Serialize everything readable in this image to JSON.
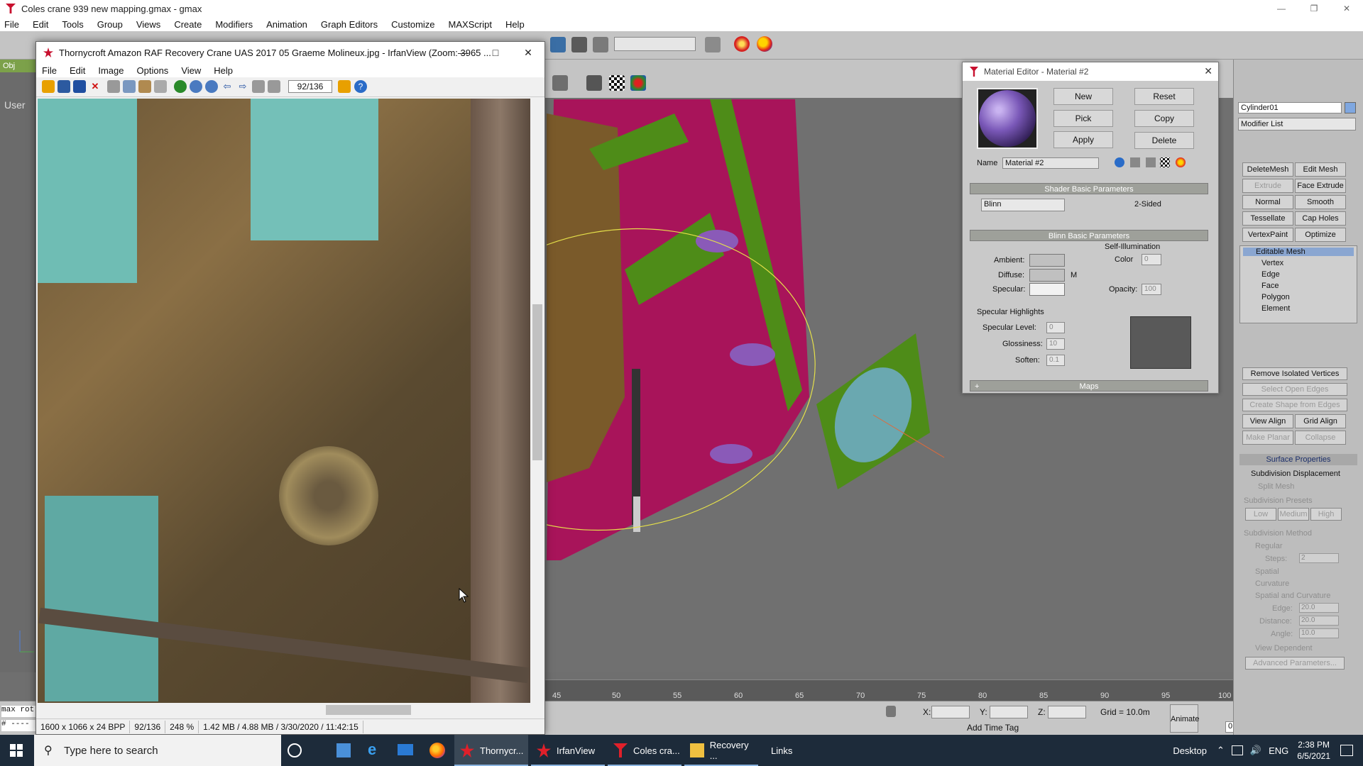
{
  "gmax": {
    "title": "Coles crane 939 new mapping.gmax - gmax",
    "menu": [
      "File",
      "Edit",
      "Tools",
      "Group",
      "Views",
      "Create",
      "Modifiers",
      "Animation",
      "Graph Editors",
      "Customize",
      "MAXScript",
      "Help"
    ],
    "viewport_label": "User",
    "sidebar_tab": "Obj",
    "timeline_ticks": [
      "45",
      "50",
      "55",
      "60",
      "65",
      "70",
      "75",
      "80",
      "85",
      "90",
      "95",
      "100"
    ],
    "status": {
      "y_label": "Y:",
      "z_label": "Z:",
      "grid": "Grid = 10.0m",
      "add_time_tag": "Add Time Tag",
      "animate": "Animate",
      "frame": "0",
      "x_label": "X:",
      "script_label": "max rot",
      "script_line": "# ----"
    }
  },
  "cmd_panel": {
    "object_name": "Cylinder01",
    "modifier_list": "Modifier List",
    "buttons": [
      [
        "DeleteMesh",
        "Edit Mesh"
      ],
      [
        "Extrude",
        "Face Extrude"
      ],
      [
        "Normal",
        "Smooth"
      ],
      [
        "Tessellate",
        "Cap Holes"
      ],
      [
        "VertexPaint",
        "Optimize"
      ]
    ],
    "stack": [
      "Editable Mesh",
      "Vertex",
      "Edge",
      "Face",
      "Polygon",
      "Element"
    ],
    "remove_isolated": "Remove Isolated Vertices",
    "select_open_edges": "Select Open Edges",
    "create_shape": "Create Shape from Edges",
    "view_align": "View Align",
    "grid_align": "Grid Align",
    "make_planar": "Make Planar",
    "collapse": "Collapse",
    "surface_props": "Surface Properties",
    "subdiv_displacement": "Subdivision Displacement",
    "split_mesh": "Split Mesh",
    "subdiv_presets": "Subdivision Presets",
    "presets": [
      "Low",
      "Medium",
      "High"
    ],
    "subdiv_method": "Subdivision Method",
    "regular": "Regular",
    "steps_label": "Steps:",
    "steps_val": "2",
    "spatial": "Spatial",
    "curvature": "Curvature",
    "spatial_curv": "Spatial and Curvature",
    "edge_label": "Edge:",
    "edge_val": "20.0",
    "distance_label": "Distance:",
    "distance_val": "20.0",
    "angle_label": "Angle:",
    "angle_val": "10.0",
    "view_dependent": "View Dependent",
    "advanced_params": "Advanced Parameters..."
  },
  "material_editor": {
    "title": "Material Editor - Material #2",
    "buttons": [
      "New",
      "Reset",
      "Pick",
      "Copy",
      "Apply",
      "Delete"
    ],
    "name_label": "Name",
    "name_value": "Material #2",
    "shader_header": "Shader Basic Parameters",
    "shader": "Blinn",
    "two_sided": "2-Sided",
    "blinn_header": "Blinn Basic Parameters",
    "self_illum": "Self-Illumination",
    "ambient": "Ambient:",
    "diffuse": "Diffuse:",
    "specular": "Specular:",
    "m_label": "M",
    "color_label": "Color",
    "color_val": "0",
    "opacity_label": "Opacity:",
    "opacity_val": "100",
    "spec_highlights": "Specular Highlights",
    "spec_level_label": "Specular Level:",
    "spec_level_val": "0",
    "glossiness_label": "Glossiness:",
    "glossiness_val": "10",
    "soften_label": "Soften:",
    "soften_val": "0.1",
    "maps": "Maps",
    "maps_plus": "+"
  },
  "irfanview": {
    "title": "Thornycroft Amazon RAF Recovery Crane UAS 2017 05 Graeme Molineux.jpg - IrfanView (Zoom: 3965 ...",
    "menu": [
      "File",
      "Edit",
      "Image",
      "Options",
      "View",
      "Help"
    ],
    "page_counter": "92/136",
    "status": [
      "1600 x 1066 x 24 BPP",
      "92/136",
      "248 %",
      "1.42 MB / 4.88 MB / 3/30/2020 / 11:42:15"
    ]
  },
  "taskbar": {
    "search_placeholder": "Type here to search",
    "apps": [
      {
        "label": "Thornycr...",
        "active": true
      },
      {
        "label": "IrfanView",
        "active": false
      },
      {
        "label": "Coles cra...",
        "active": false
      },
      {
        "label": "Recovery ...",
        "active": false
      }
    ],
    "links": "Links",
    "desktop": "Desktop",
    "lang": "ENG",
    "time": "2:38 PM",
    "date": "6/5/2021"
  }
}
